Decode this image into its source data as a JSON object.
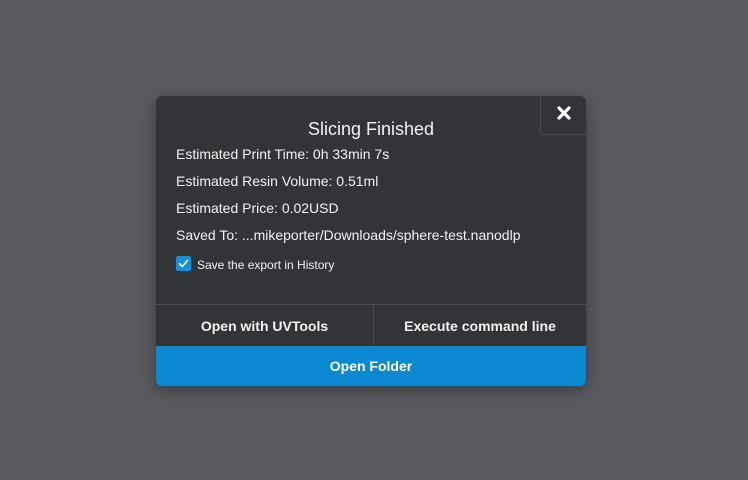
{
  "dialog": {
    "title": "Slicing Finished",
    "close_icon": "close-icon",
    "estimated_print_time": "Estimated Print Time: 0h 33min 7s",
    "estimated_resin_volume": "Estimated Resin Volume: 0.51ml",
    "estimated_price": "Estimated Price: 0.02USD",
    "saved_to": "Saved To: ...mikeporter/Downloads/sphere-test.nanodlp",
    "save_history_label": "Save the export in History",
    "save_history_checked": true,
    "buttons": {
      "open_uvtools": "Open with UVTools",
      "execute_command": "Execute command line",
      "open_folder": "Open Folder"
    }
  },
  "colors": {
    "backdrop": "#595a5e",
    "dialog_bg": "#323437",
    "accent": "#0a89d2",
    "checkbox": "#1a8fd6"
  }
}
